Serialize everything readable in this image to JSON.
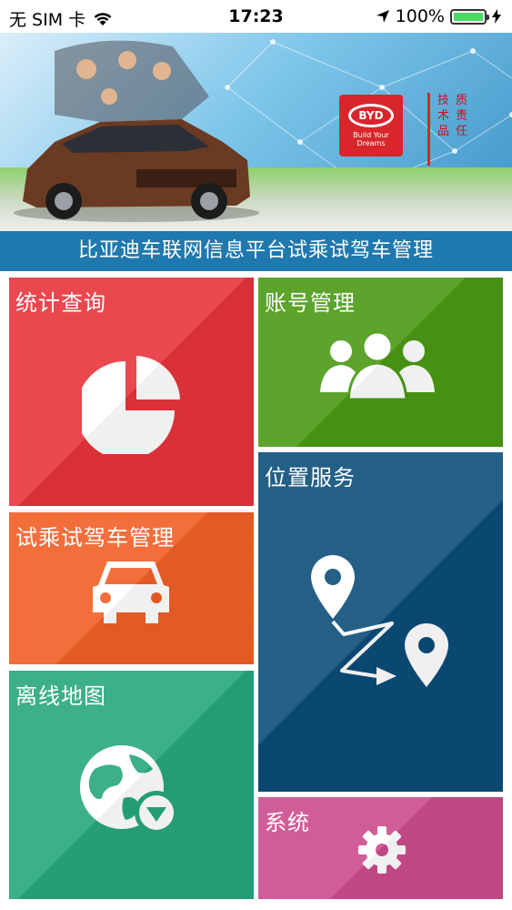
{
  "status_bar": {
    "carrier": "无 SIM 卡",
    "time": "17:23",
    "battery": "100%",
    "battery_level": 1.0
  },
  "banner": {
    "logo_text": "BYD",
    "logo_tagline": "Build Your Dreams",
    "seal_text": "技术品质责任"
  },
  "header": {
    "title": "比亚迪车联网信息平台试乘试驾车管理"
  },
  "tiles": {
    "stats": {
      "label": "统计查询",
      "icon": "pie-chart-icon",
      "color": "#e8333b"
    },
    "account": {
      "label": "账号管理",
      "icon": "users-icon",
      "color": "#4a9a14"
    },
    "test_drive": {
      "label": "试乘试驾车管理",
      "icon": "car-icon",
      "color": "#f05f26"
    },
    "location": {
      "label": "位置服务",
      "icon": "route-icon",
      "color": "#0b4d78"
    },
    "offline_map": {
      "label": "离线地图",
      "icon": "globe-download-icon",
      "color": "#27a77a"
    },
    "system": {
      "label": "系统",
      "icon": "gear-icon",
      "color": "#cc4b8c"
    }
  }
}
